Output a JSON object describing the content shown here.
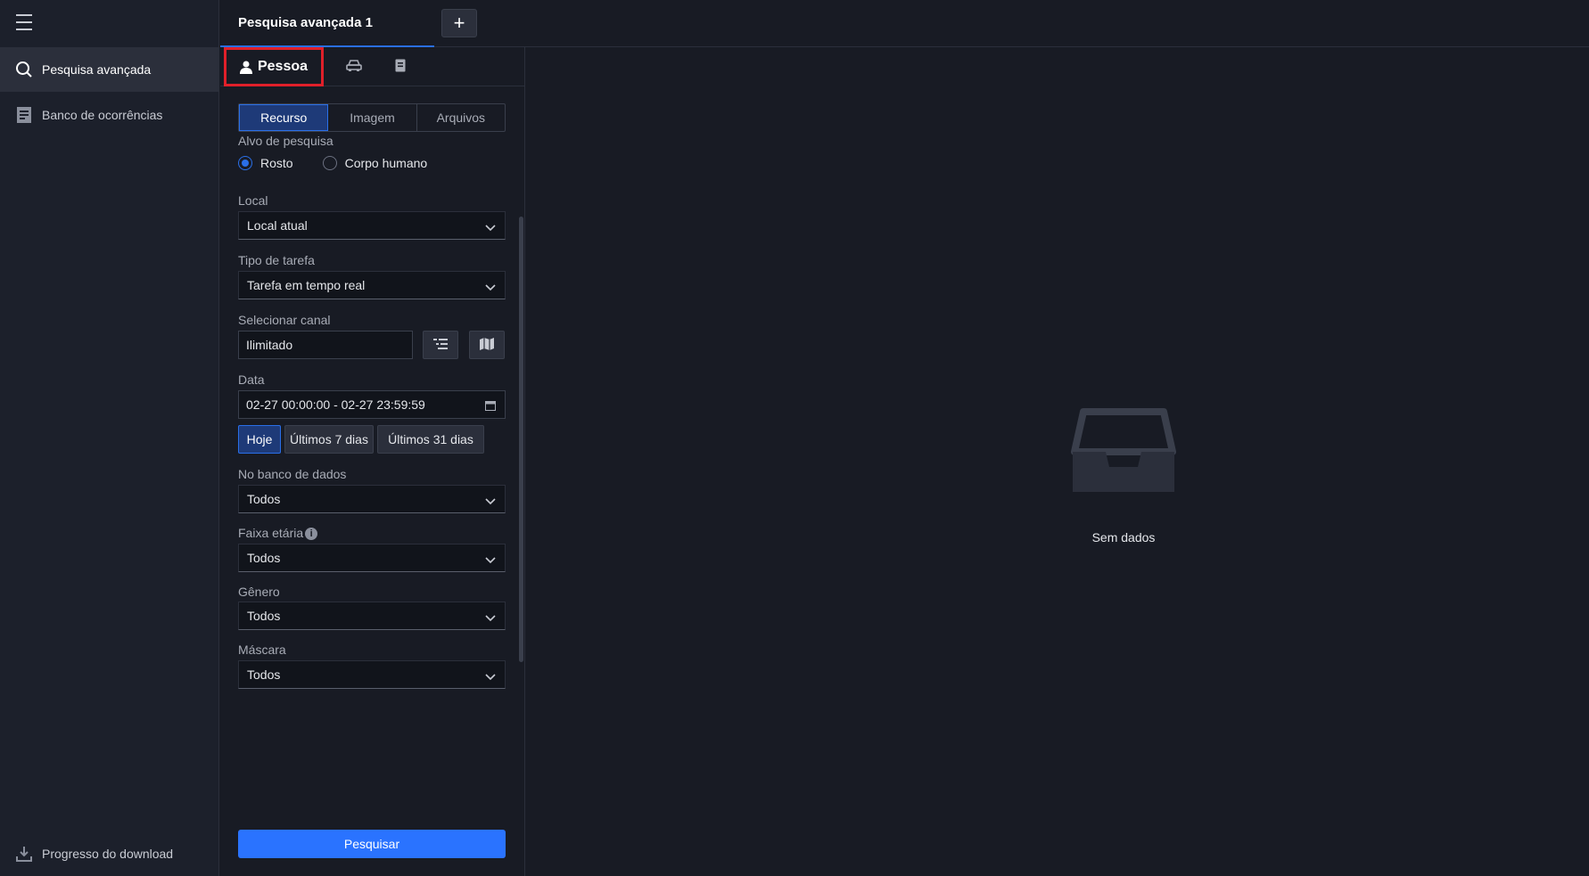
{
  "sidebar": {
    "items": [
      {
        "label": "Pesquisa avançada",
        "icon": "search-icon"
      },
      {
        "label": "Banco de ocorrências",
        "icon": "database-doc-icon"
      }
    ],
    "download": {
      "label": "Progresso do download",
      "icon": "download-icon"
    }
  },
  "tabs": {
    "active_label": "Pesquisa avançada 1",
    "add_label": "+"
  },
  "kind_tabs": {
    "person_label": "Pessoa"
  },
  "source_segments": [
    "Recurso",
    "Imagem",
    "Arquivos"
  ],
  "form": {
    "target_label": "Alvo de pesquisa",
    "target_options": [
      "Rosto",
      "Corpo humano"
    ],
    "local_label": "Local",
    "local_value": "Local atual",
    "task_label": "Tipo de tarefa",
    "task_value": "Tarefa em tempo real",
    "channel_label": "Selecionar canal",
    "channel_value": "Ilimitado",
    "date_label": "Data",
    "date_value": "02-27 00:00:00 - 02-27 23:59:59",
    "quick_dates": [
      "Hoje",
      "Últimos 7 dias",
      "Últimos 31 dias"
    ],
    "db_label": "No banco de dados",
    "db_value": "Todos",
    "age_label": "Faixa etária",
    "age_value": "Todos",
    "gender_label": "Gênero",
    "gender_value": "Todos",
    "mask_label": "Máscara",
    "mask_value": "Todos"
  },
  "search_button": "Pesquisar",
  "empty_state": {
    "text": "Sem dados"
  },
  "colors": {
    "accent": "#2a73ff",
    "highlight_border": "#e0202a"
  }
}
